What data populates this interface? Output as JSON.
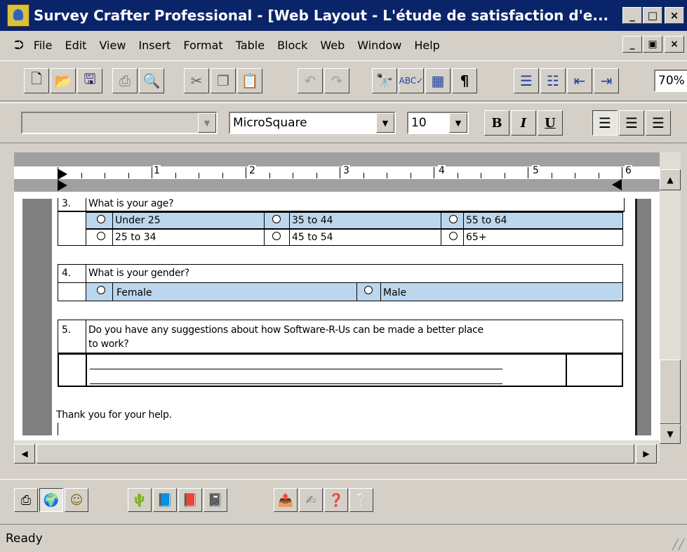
{
  "window": {
    "title": "Survey Crafter Professional - [Web Layout - L'étude de satisfaction d'e...",
    "min": "_",
    "max": "□",
    "close": "×"
  },
  "menu": {
    "items": [
      "File",
      "Edit",
      "View",
      "Insert",
      "Format",
      "Table",
      "Block",
      "Web",
      "Window",
      "Help"
    ]
  },
  "toolbar": {
    "zoom": "70%"
  },
  "format": {
    "style": "",
    "font": "MicroSquare",
    "size": "10",
    "bold": "B",
    "italic": "I",
    "underline": "U"
  },
  "ruler": {
    "marks": [
      "1",
      "2",
      "3",
      "4",
      "5",
      "6"
    ]
  },
  "survey": {
    "q3": {
      "num": "3.",
      "text": "What is your age?",
      "options": [
        "Under 25",
        "35 to 44",
        "55 to 64",
        "25 to 34",
        "45 to 54",
        "65+"
      ]
    },
    "q4": {
      "num": "4.",
      "text": "What is your gender?",
      "options": [
        "Female",
        "Male"
      ]
    },
    "q5": {
      "num": "5.",
      "text_line1": "Do you have any suggestions about how Software-R-Us can be made a better place",
      "text_line2": "to work?"
    },
    "thanks": "Thank you for your help."
  },
  "status": {
    "text": "Ready"
  },
  "icons": {
    "colors": {
      "titlebar": "#0a246a",
      "option_row": "#bcd6ee"
    }
  }
}
